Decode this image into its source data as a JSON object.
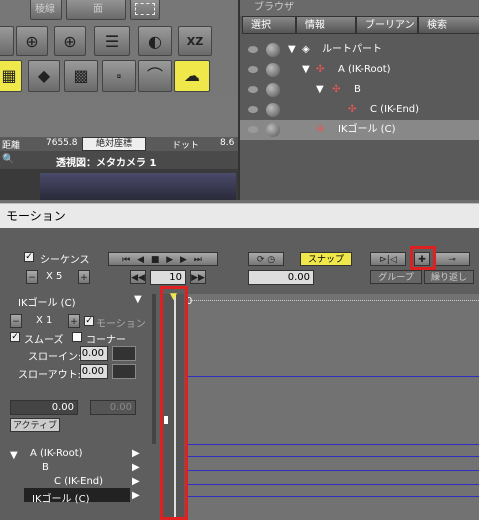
{
  "toolbar": {
    "top_btn1_label": "稜線",
    "top_btn2_label": "面",
    "xz_label": "XZ"
  },
  "status": {
    "distance_label": "距離",
    "distance_value": "7655.8",
    "coord_mode": "絶対座標",
    "dot_label": "ドット",
    "dot_value": "8.6"
  },
  "viewport": {
    "title": "透視図：メタカメラ 1"
  },
  "browser": {
    "title": "ブラウザ",
    "tabs": [
      "選択",
      "情報",
      "ブーリアン",
      "検索"
    ],
    "tree": [
      {
        "label": "ルートパート"
      },
      {
        "label": "A (IK-Root)"
      },
      {
        "label": "B"
      },
      {
        "label": "C (IK-End)"
      },
      {
        "label": "IKゴール (C)"
      }
    ]
  },
  "motion": {
    "title": "モーション",
    "sequence_label": "シーケンス",
    "x5_label": "X 5",
    "snap_label": "スナップ",
    "frame_value": "10",
    "time_value": "0.00",
    "group_label": "グループ",
    "repeat_label": "繰り返し",
    "selected_part": "IKゴール (C)",
    "x1_label": "X 1",
    "motion_label": "モーション",
    "smooth_label": "スムーズ",
    "corner_label": "コーナー",
    "slow_in_label": "スローイン:",
    "slow_in_value": "0.00",
    "slow_out_label": "スローアウト:",
    "slow_out_value": "0.00",
    "value1": "0.00",
    "value2": "0.00",
    "active_label": "アクティブ",
    "ruler_start": "0",
    "tracks": [
      {
        "label": "A (IK-Root)"
      },
      {
        "label": "B"
      },
      {
        "label": "C (IK-End)"
      },
      {
        "label": "IKゴール (C)"
      }
    ]
  }
}
